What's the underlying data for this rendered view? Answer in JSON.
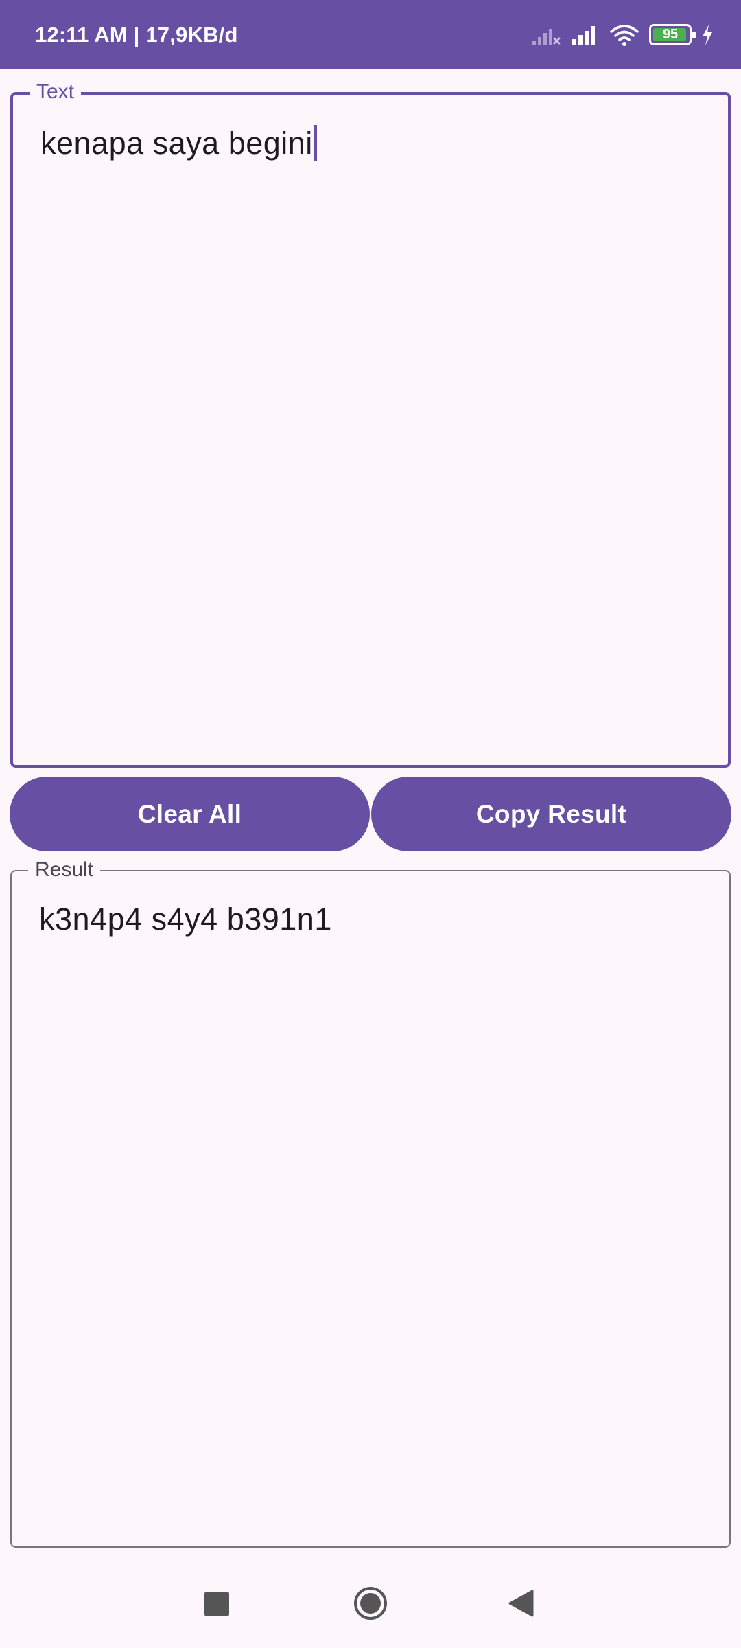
{
  "status_bar": {
    "time_speed": "12:11 AM | 17,9KB/d",
    "battery_level": "95",
    "battery_percent": 95,
    "colors": {
      "background": "#6750a4",
      "battery_fill": "#4caf50"
    },
    "icons": [
      "signal-off-icon",
      "signal-icon",
      "wifi-icon",
      "battery-icon",
      "charging-icon"
    ]
  },
  "input_field": {
    "label": "Text",
    "value": "kenapa saya begini",
    "focused": true
  },
  "buttons": {
    "clear_label": "Clear All",
    "copy_label": "Copy Result"
  },
  "result_field": {
    "label": "Result",
    "value": "k3n4p4 s4y4 b391n1"
  },
  "navigation": {
    "icons": [
      "recents-icon",
      "home-icon",
      "back-icon"
    ]
  },
  "theme": {
    "primary": "#6750a4",
    "surface": "#fdf7fc",
    "outline": "#79747e",
    "on_surface": "#1d1b20"
  }
}
